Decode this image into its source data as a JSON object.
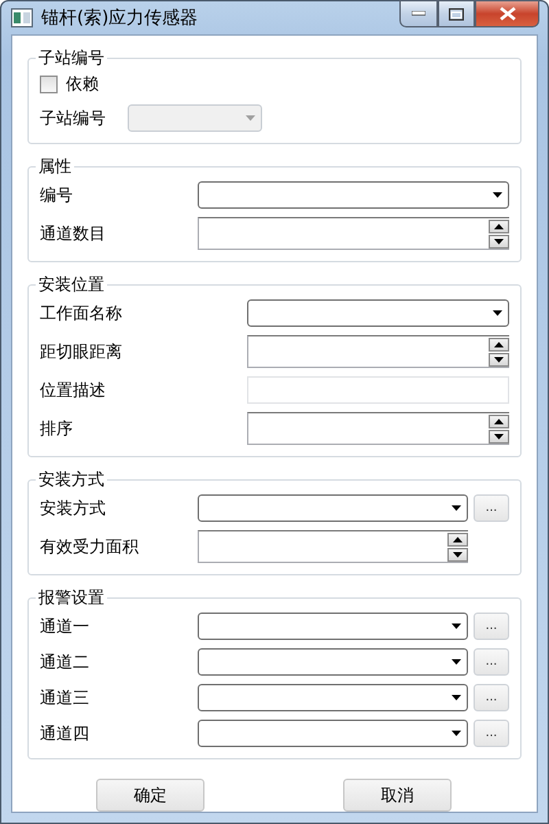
{
  "window": {
    "title": "锚杆(索)应力传感器"
  },
  "groups": [
    {
      "title": "子站编号",
      "rows": [
        {
          "kind": "checkbox",
          "label": "依赖",
          "checked": false
        },
        {
          "kind": "combo",
          "label": "子站编号",
          "disabled": true
        }
      ]
    },
    {
      "title": "属性",
      "rows": [
        {
          "kind": "combo",
          "label": "编号",
          "disabled": false
        },
        {
          "kind": "spin",
          "label": "通道数目"
        }
      ]
    },
    {
      "title": "安装位置",
      "rows": [
        {
          "kind": "combo",
          "label": "工作面名称",
          "disabled": false
        },
        {
          "kind": "spin",
          "label": "距切眼距离"
        },
        {
          "kind": "text",
          "label": "位置描述"
        },
        {
          "kind": "spin",
          "label": "排序"
        }
      ]
    },
    {
      "title": "安装方式",
      "rows": [
        {
          "kind": "combo_more",
          "label": "安装方式",
          "more": "..."
        },
        {
          "kind": "spin",
          "label": "有效受力面积"
        }
      ]
    },
    {
      "title": "报警设置",
      "rows": [
        {
          "kind": "combo_more",
          "label": "通道一",
          "more": "..."
        },
        {
          "kind": "combo_more",
          "label": "通道二",
          "more": "..."
        },
        {
          "kind": "combo_more",
          "label": "通道三",
          "more": "..."
        },
        {
          "kind": "combo_more",
          "label": "通道四",
          "more": "..."
        }
      ]
    }
  ],
  "buttons": [
    "确定",
    "取消"
  ]
}
